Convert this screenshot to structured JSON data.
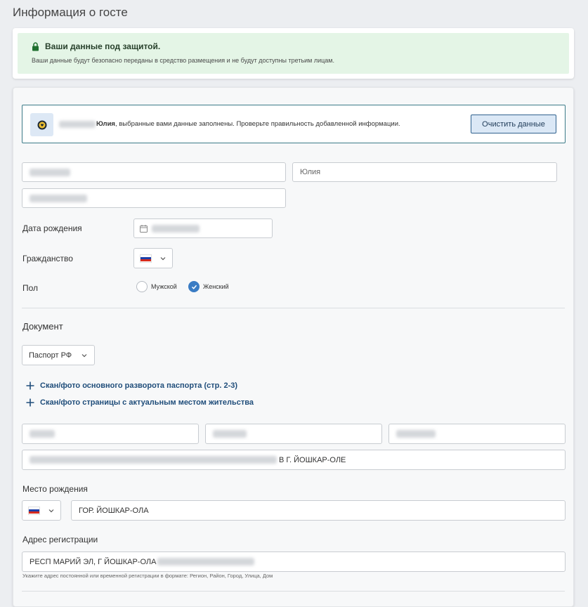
{
  "page_title": "Информация о госте",
  "security": {
    "title": "Ваши данные под защитой.",
    "text": "Ваши данные будут безопасно переданы в средство размещения и не будут доступны третьим лицам."
  },
  "prefill": {
    "name": "Юлия",
    "text": ", выбранные вами данные заполнены. Проверьте правильность добавленной информации.",
    "clear_label": "Очистить данные"
  },
  "fields": {
    "first_name": "Юлия"
  },
  "birth_date_label": "Дата рождения",
  "citizenship_label": "Гражданство",
  "gender": {
    "label": "Пол",
    "male": "Мужской",
    "female": "Женский",
    "selected": "Женский"
  },
  "document": {
    "title": "Документ",
    "type": "Паспорт РФ",
    "upload_main": "Скан/фото основного разворота паспорта (стр. 2-3)",
    "upload_residence": "Скан/фото страницы с актуальным местом жительства",
    "issued_by_suffix": "В Г. ЙОШКАР-ОЛЕ"
  },
  "birthplace": {
    "label": "Место рождения",
    "value": "ГОР. ЙОШКАР-ОЛА"
  },
  "registration": {
    "label": "Адрес регистрации",
    "value": "РЕСП МАРИЙ ЭЛ, Г ЙОШКАР-ОЛА",
    "hint": "Укажите адрес постоянной или временной регистрации в формате: Регион, Район, Город, Улица, Дом"
  },
  "colors": {
    "accent": "#3a7cc4",
    "link": "#1f4d7a",
    "security_bg": "#e4f5e6"
  }
}
